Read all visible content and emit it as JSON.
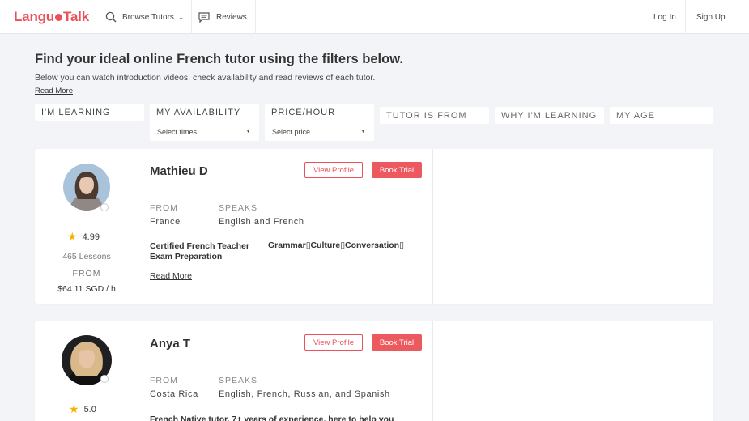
{
  "header": {
    "logo": "LanguaTalk",
    "logo_parts": [
      "Langu",
      "Talk"
    ],
    "browse": "Browse Tutors",
    "reviews": "Reviews",
    "login": "Log In",
    "signup": "Sign Up",
    "brand_color": "#e9525a"
  },
  "intro": {
    "title": "Find your ideal online French tutor using the filters below.",
    "subtitle": "Below you can watch introduction videos, check availability and read reviews of each tutor.",
    "read_more": "Read More"
  },
  "filters": {
    "learning": "I'M LEARNING",
    "availability": "MY AVAILABILITY",
    "availability_value": "Select times",
    "price": "PRICE/HOUR",
    "price_value": "Select price",
    "from": "TUTOR IS FROM",
    "why": "WHY I'M LEARNING",
    "age": "MY AGE"
  },
  "tutors": [
    {
      "name": "Mathieu D",
      "rating": "4.99",
      "lessons": "465 Lessons",
      "from_label": "FROM",
      "price": "$64.11 SGD / h",
      "view_profile": "View Profile",
      "book_trial": "Book Trial",
      "from_heading": "FROM",
      "from": "France",
      "speaks_heading": "SPEAKS",
      "speaks": "English and French",
      "tag_a": "Certified French Teacher",
      "tag_b": "Grammar▯Culture▯Conversation▯",
      "tag_c": "Exam Preparation",
      "read_more": "Read More"
    },
    {
      "name": "Anya T",
      "rating": "5.0",
      "view_profile": "View Profile",
      "book_trial": "Book Trial",
      "from_heading": "FROM",
      "from": "Costa Rica",
      "speaks_heading": "SPEAKS",
      "speaks": "English, French, Russian, and Spanish",
      "tagline": "French Native tutor, 7+ years of experience, here to help you"
    }
  ]
}
